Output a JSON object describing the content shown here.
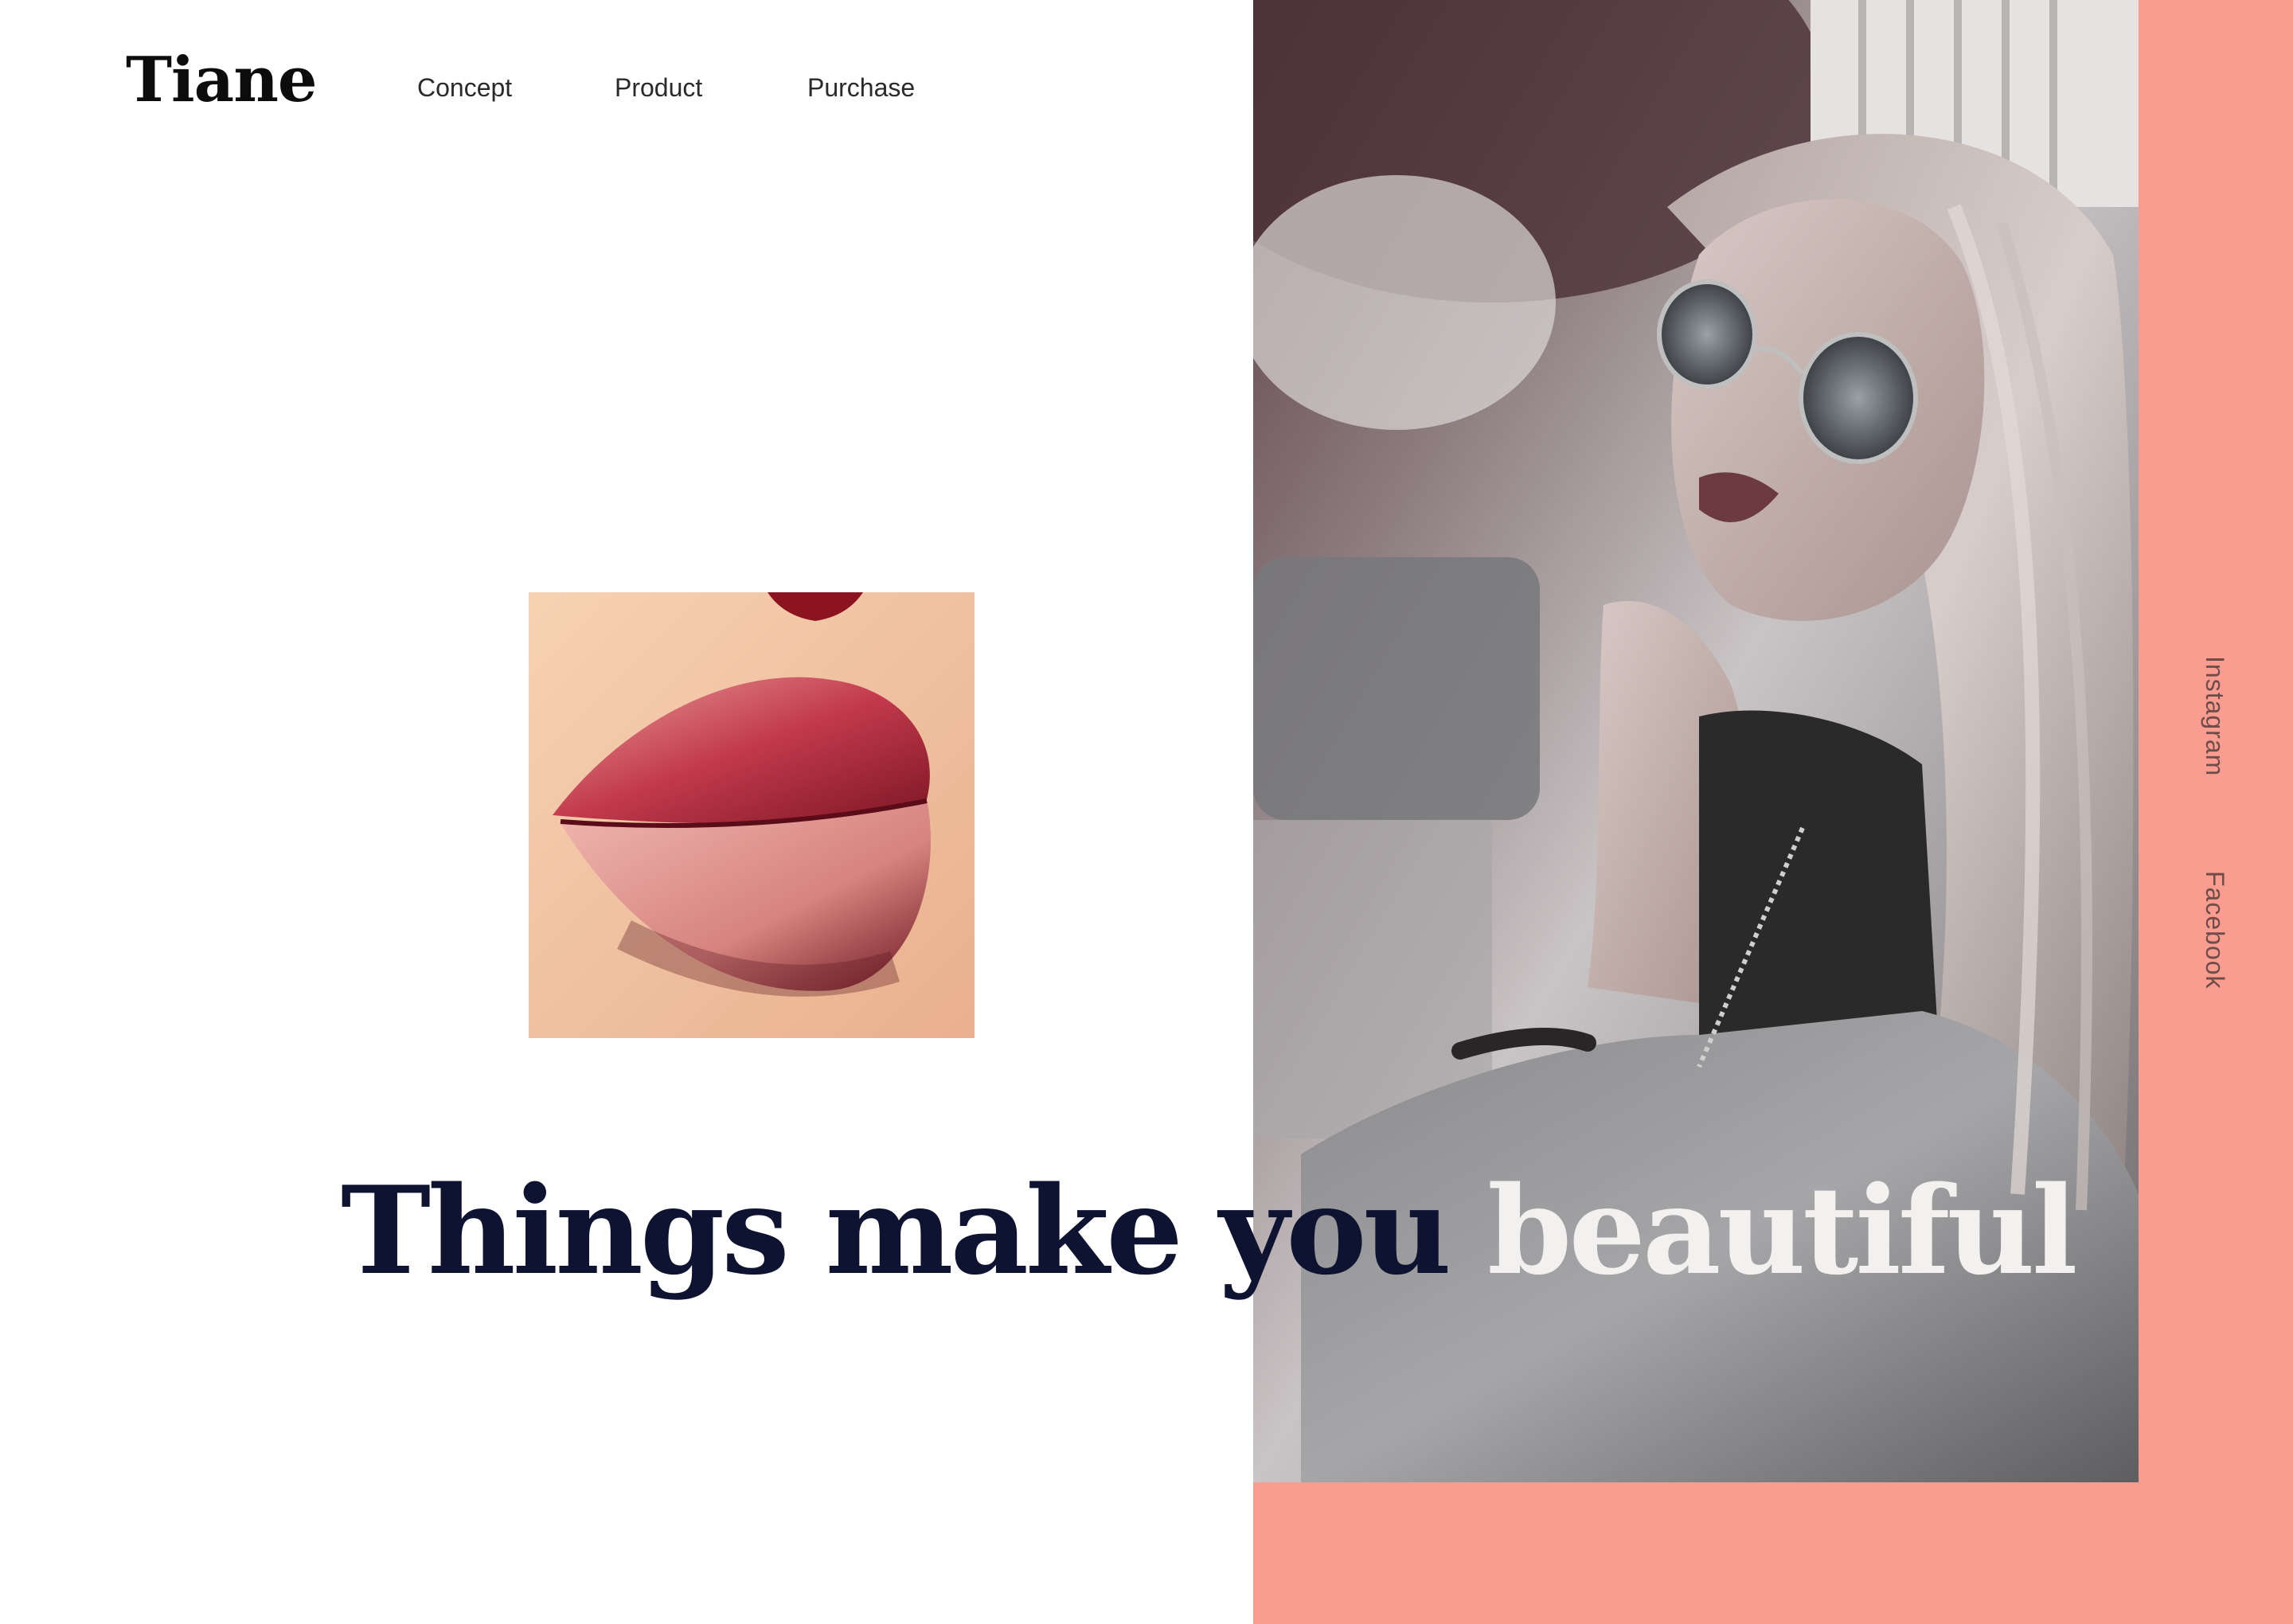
{
  "brand": {
    "logo": "Tiane"
  },
  "nav": {
    "items": [
      {
        "label": "Concept"
      },
      {
        "label": "Product"
      },
      {
        "label": "Purchase"
      }
    ]
  },
  "hero": {
    "headline_dark": "Things make you ",
    "headline_light": "beautiful"
  },
  "social": {
    "instagram": "Instagram",
    "facebook": "Facebook"
  },
  "colors": {
    "accent_coral": "#fb9c90",
    "headline_navy": "#0d1330",
    "background": "#ffffff"
  }
}
